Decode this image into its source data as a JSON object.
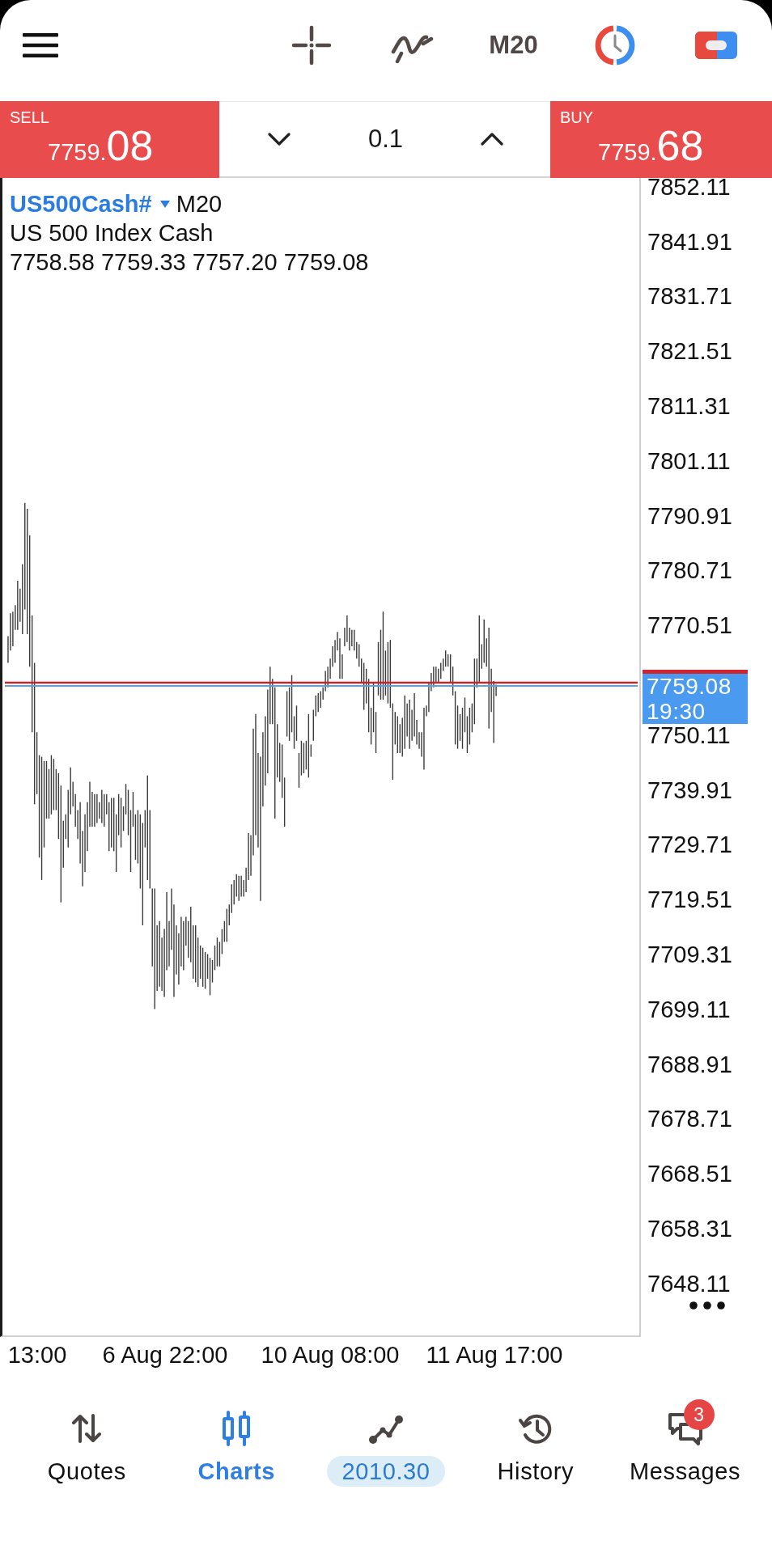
{
  "toolbar": {
    "timeframe": "M20"
  },
  "trade_panel": {
    "sell": {
      "label": "SELL",
      "price_main": "7759.",
      "price_large": "08"
    },
    "volume": "0.1",
    "buy": {
      "label": "BUY",
      "price_main": "7759.",
      "price_large": "68"
    }
  },
  "chart": {
    "symbol": "US500Cash#",
    "timeframe": "M20",
    "description": "US 500 Index Cash",
    "ohlc": "7758.58 7759.33 7757.20 7759.08",
    "price_axis": {
      "above_tag": [
        "7852.11",
        "7841.91",
        "7831.71",
        "7821.51",
        "7811.31",
        "7801.11",
        "7790.91",
        "7780.71",
        "7770.51"
      ],
      "below_tag": [
        "7750.11",
        "7739.91",
        "7729.71",
        "7719.51",
        "7709.31",
        "7699.11",
        "7688.91",
        "7678.71",
        "7668.51",
        "7658.31",
        "7648.11"
      ]
    },
    "price_tag": {
      "price": "7759.08",
      "time": "19:30"
    },
    "time_axis": [
      "13:00",
      "6 Aug 22:00",
      "10 Aug 08:00",
      "11 Aug 17:00"
    ]
  },
  "nav": {
    "items": [
      {
        "kind": "tab",
        "label": "Quotes",
        "selected": false
      },
      {
        "kind": "tab",
        "label": "Charts",
        "selected": true
      },
      {
        "kind": "amount",
        "label": "2010.30",
        "selected": false
      },
      {
        "kind": "tab",
        "label": "History",
        "selected": false
      },
      {
        "kind": "tab",
        "label": "Messages",
        "selected": false,
        "badge": "3"
      }
    ]
  }
}
